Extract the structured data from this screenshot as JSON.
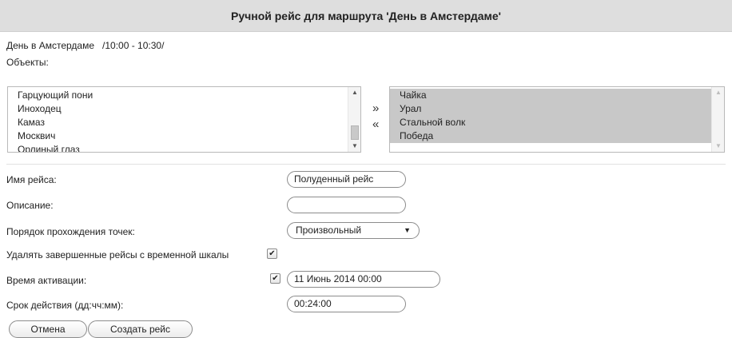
{
  "dialog": {
    "title": "Ручной рейс для маршрута 'День в Амстердаме'"
  },
  "route": {
    "name": "День в Амстердаме",
    "time": "/10:00 - 10:30/"
  },
  "objects": {
    "label": "Объекты:",
    "available": [
      "Гарцующий пони",
      "Иноходец",
      "Камаз",
      "Москвич",
      "Орлиный глаз"
    ],
    "selected": [
      "Чайка",
      "Урал",
      "Стальной волк",
      "Победа"
    ],
    "move_right": "»",
    "move_left": "«"
  },
  "form": {
    "trip_name_label": "Имя рейса:",
    "trip_name_value": "Полуденный рейс",
    "description_label": "Описание:",
    "description_value": "",
    "order_label": "Порядок прохождения точек:",
    "order_value": "Произвольный",
    "delete_finished_label": "Удалять завершенные рейсы с временной шкалы",
    "delete_finished_checked": true,
    "activation_label": "Время активации:",
    "activation_checked": true,
    "activation_value": "11 Июнь 2014 00:00",
    "duration_label": "Срок действия (дд:чч:мм):",
    "duration_value": "00:24:00"
  },
  "buttons": {
    "cancel": "Отмена",
    "create": "Создать рейс"
  }
}
